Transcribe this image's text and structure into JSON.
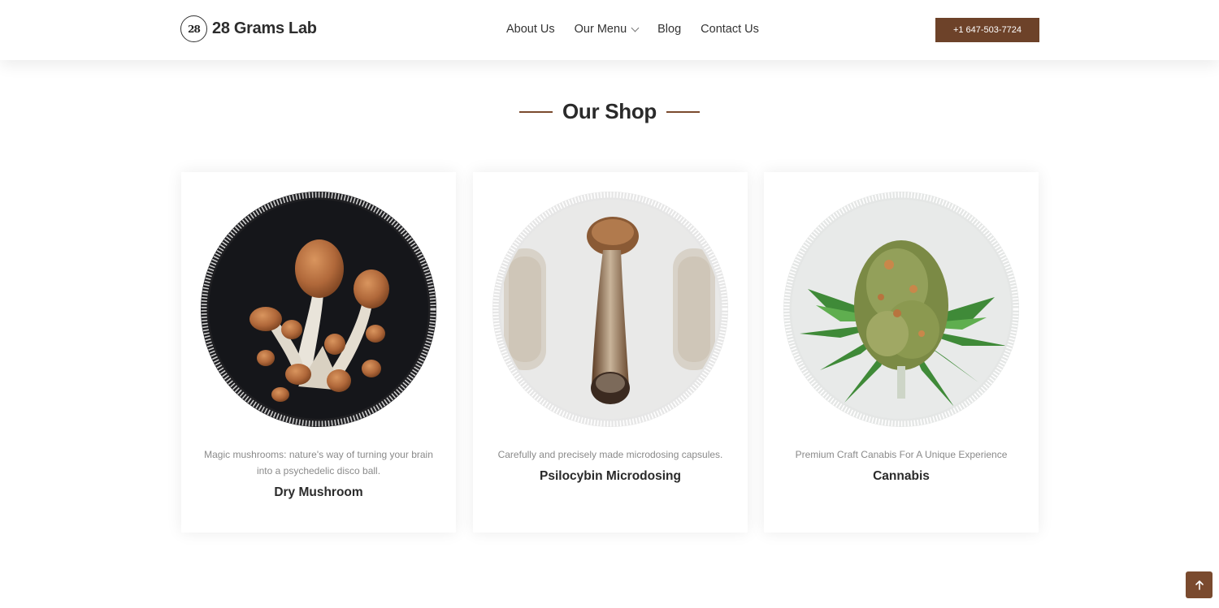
{
  "brand": {
    "name": "28 Grams Lab",
    "mark": "28"
  },
  "nav": [
    {
      "label": "About Us"
    },
    {
      "label": "Our Menu"
    },
    {
      "label": "Blog"
    },
    {
      "label": "Contact Us"
    }
  ],
  "phone": "+1 647-503-7724",
  "section": {
    "title": "Our Shop"
  },
  "cards": [
    {
      "description": "Magic mushrooms: nature's way of turning your brain into a psychedelic disco ball.",
      "title": "Dry Mushroom",
      "image": "dried-mushrooms-image"
    },
    {
      "description": "Carefully and precisely made microdosing capsules.",
      "title": "Psilocybin Microdosing",
      "image": "mushroom-capsules-image"
    },
    {
      "description": "Premium Craft Canabis For A Unique Experience",
      "title": "Cannabis",
      "image": "cannabis-bud-image"
    }
  ],
  "colors": {
    "accent": "#6d4229",
    "title_line": "#7a4a2e"
  },
  "icons": {
    "scroll_top": "arrow-up-icon",
    "dropdown": "chevron-down-icon"
  }
}
